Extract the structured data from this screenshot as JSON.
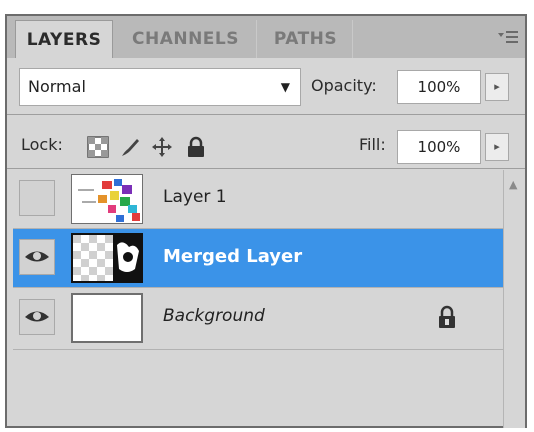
{
  "tabs": [
    {
      "label": "LAYERS",
      "active": true
    },
    {
      "label": "CHANNELS",
      "active": false
    },
    {
      "label": "PATHS",
      "active": false
    }
  ],
  "blend": {
    "mode": "Normal",
    "opacity_label": "Opacity:",
    "opacity_value": "100%"
  },
  "lock": {
    "label": "Lock:",
    "fill_label": "Fill:",
    "fill_value": "100%"
  },
  "layers": [
    {
      "name": "Layer 1",
      "visible": false,
      "selected": false,
      "locked": false
    },
    {
      "name": "Merged Layer",
      "visible": true,
      "selected": true,
      "locked": false
    },
    {
      "name": "Background",
      "visible": true,
      "selected": false,
      "locked": true,
      "italic": true
    }
  ],
  "colors": {
    "selection": "#3b93e8",
    "panel": "#d6d6d6",
    "tabbar": "#b9b9b9"
  }
}
